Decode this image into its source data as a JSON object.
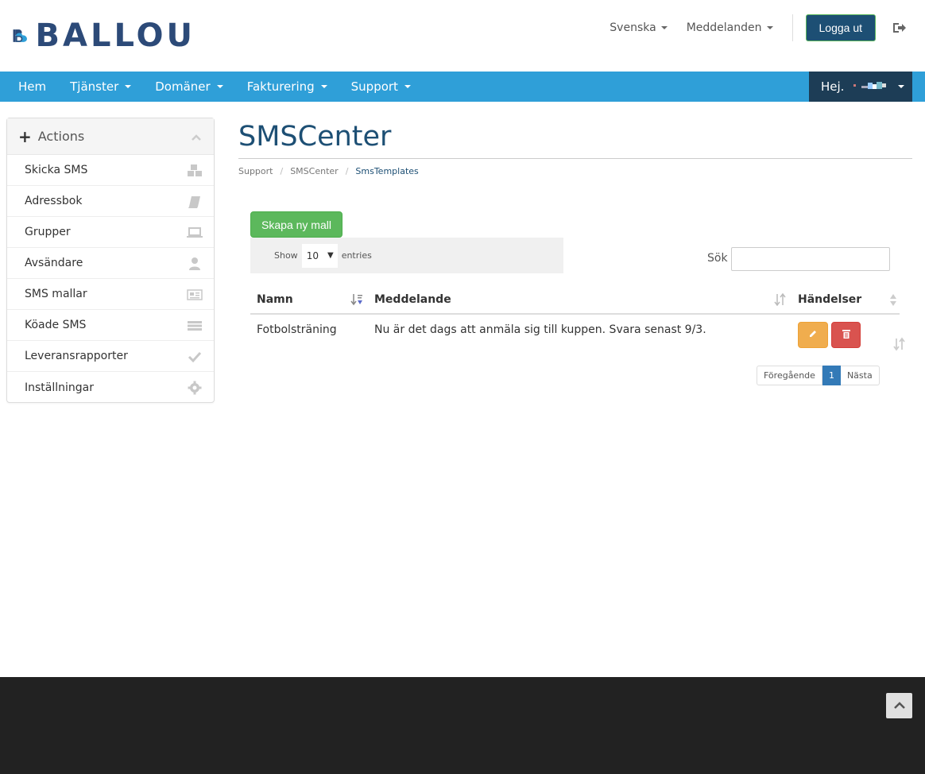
{
  "brand": {
    "name": "BALLOU"
  },
  "topbar": {
    "language": "Svenska",
    "notifications": "Meddelanden",
    "logout": "Logga ut"
  },
  "nav": {
    "items": [
      {
        "label": "Hem"
      },
      {
        "label": "Tjänster"
      },
      {
        "label": "Domäner"
      },
      {
        "label": "Fakturering"
      },
      {
        "label": "Support"
      }
    ],
    "greeting": "Hej."
  },
  "sidebar": {
    "title": "Actions",
    "items": [
      {
        "label": "Skicka SMS",
        "icon": "cubes-icon"
      },
      {
        "label": "Adressbok",
        "icon": "book-icon"
      },
      {
        "label": "Grupper",
        "icon": "laptop-icon"
      },
      {
        "label": "Avsändare",
        "icon": "user-icon"
      },
      {
        "label": "SMS mallar",
        "icon": "newspaper-icon"
      },
      {
        "label": "Köade SMS",
        "icon": "list-icon"
      },
      {
        "label": "Leveransrapporter",
        "icon": "check-icon"
      },
      {
        "label": "Inställningar",
        "icon": "gear-icon"
      }
    ]
  },
  "page": {
    "title": "SMSCenter",
    "breadcrumb": [
      "Support",
      "SMSCenter",
      "SmsTemplates"
    ]
  },
  "toolbar": {
    "create_label": "Skapa ny mall",
    "show_label": "Show",
    "entries_value": "10",
    "entries_label": "entries",
    "search_label": "Sök",
    "search_value": ""
  },
  "table": {
    "columns": [
      "Namn",
      "Meddelande",
      "Händelser"
    ],
    "rows": [
      {
        "name": "Fotbolsträning",
        "message": "Nu är det dags att anmäla sig till kuppen. Svara senast 9/3."
      }
    ]
  },
  "pagination": {
    "prev": "Föregående",
    "current": "1",
    "next": "Nästa"
  },
  "colors": {
    "nav_bg": "#2f9fd8",
    "brand_dark": "#1d4f74",
    "success": "#5cb85c",
    "warning": "#f0ad4e",
    "danger": "#d9534f",
    "footer_bg": "#222222"
  }
}
